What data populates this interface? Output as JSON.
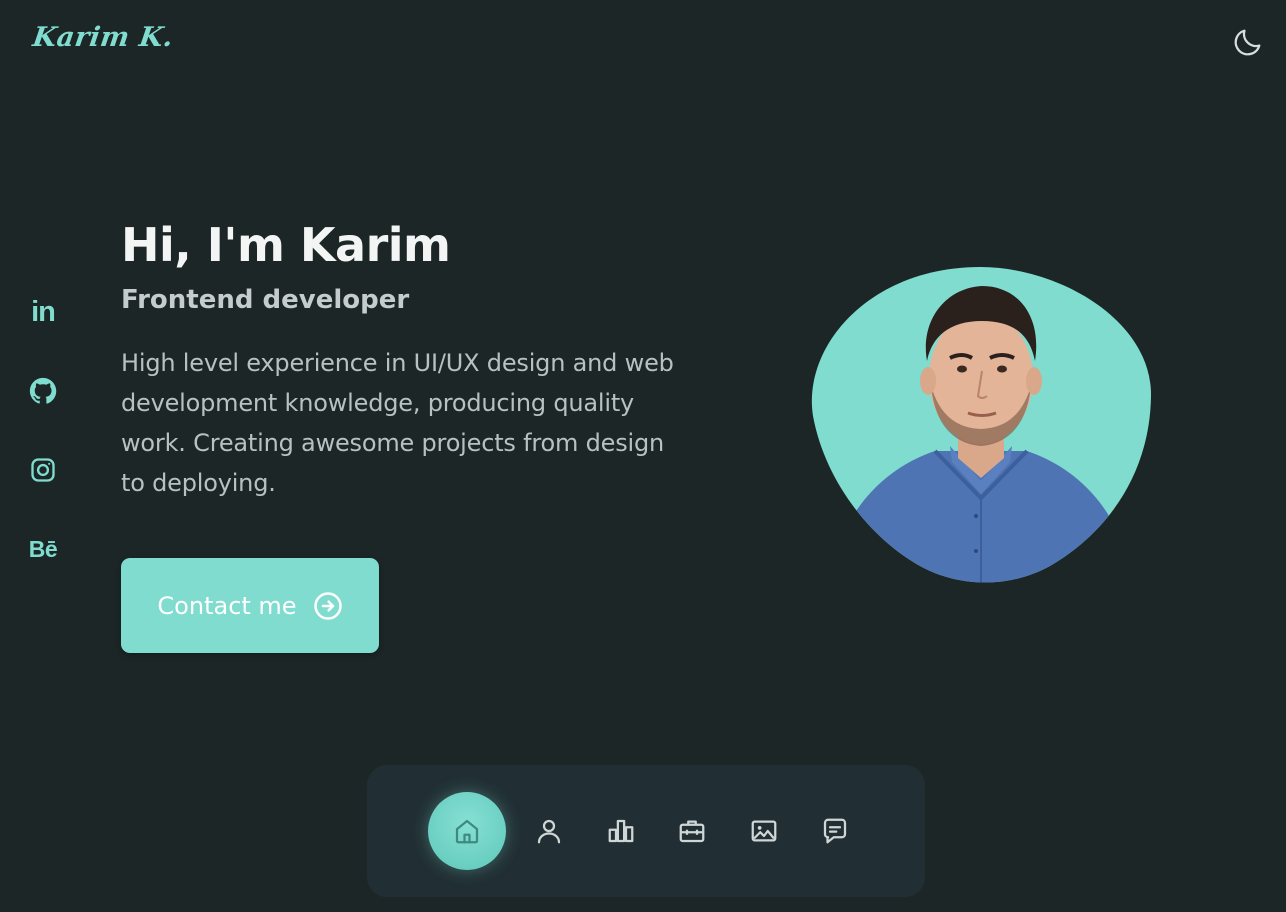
{
  "header": {
    "logo_text": "Karim K.",
    "theme_toggle_icon": "moon-icon"
  },
  "social": {
    "items": [
      {
        "name": "linkedin",
        "icon": "linkedin-icon",
        "label": "in"
      },
      {
        "name": "github",
        "icon": "github-icon"
      },
      {
        "name": "instagram",
        "icon": "instagram-icon"
      },
      {
        "name": "behance",
        "icon": "behance-icon",
        "label": "Bē"
      }
    ]
  },
  "hero": {
    "title": "Hi, I'm Karim",
    "subtitle": "Frontend developer",
    "description": "High level experience in UI/UX design and web development knowledge, producing quality work. Creating awesome projects from design to deploying.",
    "cta_label": "Contact me",
    "cta_icon": "arrow-circle-right-icon",
    "photo_alt": "Profile photo"
  },
  "nav": {
    "items": [
      {
        "name": "home",
        "icon": "home-icon",
        "active": true
      },
      {
        "name": "about",
        "icon": "user-icon",
        "active": false
      },
      {
        "name": "skills",
        "icon": "bar-chart-icon",
        "active": false
      },
      {
        "name": "services",
        "icon": "briefcase-icon",
        "active": false
      },
      {
        "name": "portfolio",
        "icon": "image-icon",
        "active": false
      },
      {
        "name": "contact",
        "icon": "message-icon",
        "active": false
      }
    ]
  },
  "colors": {
    "background": "#1c2626",
    "accent": "#7fdccf",
    "nav_background": "#212f34",
    "title_text": "#f3f5f5",
    "body_text": "#b8c0c0"
  }
}
